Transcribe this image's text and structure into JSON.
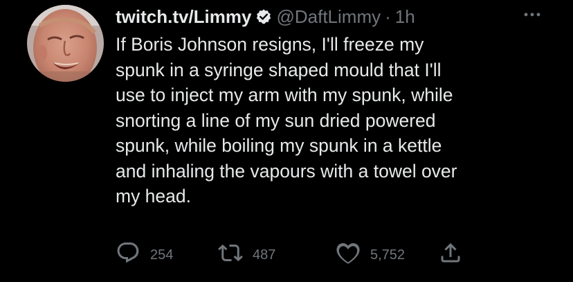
{
  "author": {
    "display_name": "twitch.tv/Limmy",
    "handle": "@DaftLimmy",
    "separator": "·",
    "time": "1h",
    "verified": true
  },
  "tweet": {
    "text": "If Boris Johnson resigns, I'll freeze my\nspunk in a syringe shaped mould that I'll\nuse to inject my arm with my spunk, while\nsnorting a line of my sun dried powered\nspunk, while boiling my spunk in a kettle\nand inhaling the vapours with a towel over\nmy head."
  },
  "actions": {
    "reply_count": "254",
    "retweet_count": "487",
    "like_count": "5,752"
  },
  "icons": {
    "verified": "verified-badge-icon",
    "more": "more-dots-icon",
    "reply": "reply-icon",
    "retweet": "retweet-icon",
    "like": "heart-icon",
    "share": "share-icon"
  },
  "colors": {
    "background": "#000000",
    "primary_text": "#e7e9ea",
    "secondary_text": "#71767b"
  }
}
